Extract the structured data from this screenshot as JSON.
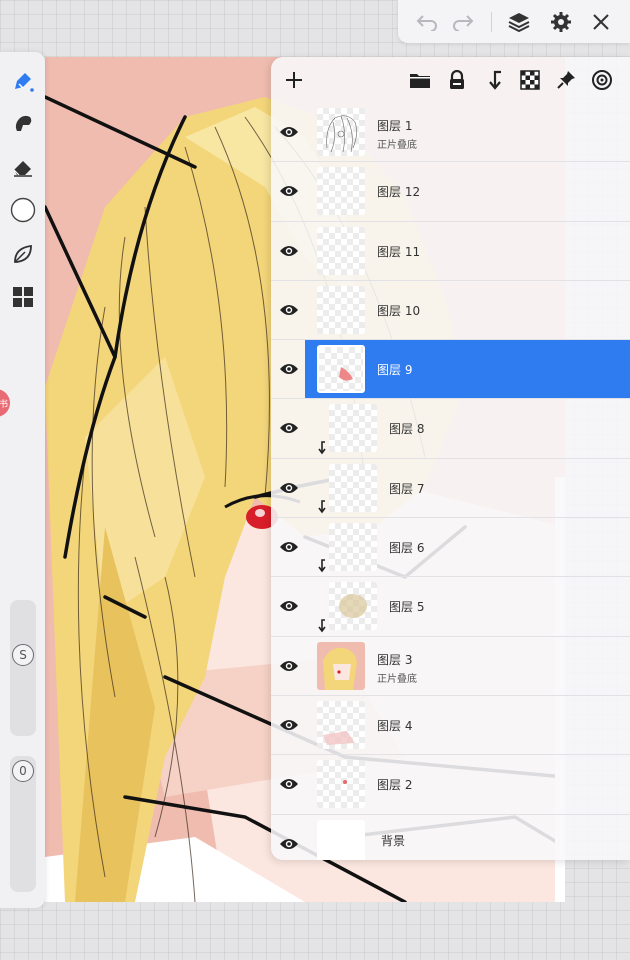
{
  "toolbar": {
    "undo_icon": "undo-icon",
    "redo_icon": "redo-icon",
    "layers_icon": "layers-icon",
    "settings_icon": "gear-icon",
    "close_icon": "close-icon"
  },
  "left_tools": [
    "brush-icon",
    "smudge-icon",
    "eraser-icon",
    "color-circle-icon",
    "leaf-icon",
    "grid-icon"
  ],
  "left_panel": {
    "badge": "书",
    "size_slider_label": "S",
    "opacity_slider_label": "0"
  },
  "layers_header": {
    "icons": [
      "add-icon",
      "folder-icon",
      "lock-icon",
      "clip-icon",
      "checker-icon",
      "pin-icon",
      "target-icon"
    ]
  },
  "layers": [
    {
      "name": "图层 1",
      "blend": "正片叠底",
      "visible": true,
      "selected": false,
      "clipped": false,
      "indent": false
    },
    {
      "name": "图层 12",
      "blend": "",
      "visible": true,
      "selected": false,
      "clipped": false,
      "indent": false
    },
    {
      "name": "图层 11",
      "blend": "",
      "visible": true,
      "selected": false,
      "clipped": false,
      "indent": false
    },
    {
      "name": "图层 10",
      "blend": "",
      "visible": true,
      "selected": false,
      "clipped": false,
      "indent": false
    },
    {
      "name": "图层 9",
      "blend": "",
      "visible": true,
      "selected": true,
      "clipped": false,
      "indent": false
    },
    {
      "name": "图层 8",
      "blend": "",
      "visible": true,
      "selected": false,
      "clipped": true,
      "indent": true
    },
    {
      "name": "图层 7",
      "blend": "",
      "visible": true,
      "selected": false,
      "clipped": true,
      "indent": true
    },
    {
      "name": "图层 6",
      "blend": "",
      "visible": true,
      "selected": false,
      "clipped": true,
      "indent": true
    },
    {
      "name": "图层 5",
      "blend": "",
      "visible": true,
      "selected": false,
      "clipped": true,
      "indent": true
    },
    {
      "name": "图层 3",
      "blend": "正片叠底",
      "visible": true,
      "selected": false,
      "clipped": false,
      "indent": false
    },
    {
      "name": "图层 4",
      "blend": "",
      "visible": true,
      "selected": false,
      "clipped": false,
      "indent": false
    },
    {
      "name": "图层 2",
      "blend": "",
      "visible": true,
      "selected": false,
      "clipped": false,
      "indent": false
    },
    {
      "name": "背景",
      "blend": "",
      "visible": true,
      "selected": false,
      "clipped": false,
      "indent": false
    }
  ],
  "colors": {
    "accent": "#2f7cf0",
    "canvas_bg": "#efbcaf",
    "hair": "#f3d57a",
    "eye": "#d81e2a"
  }
}
